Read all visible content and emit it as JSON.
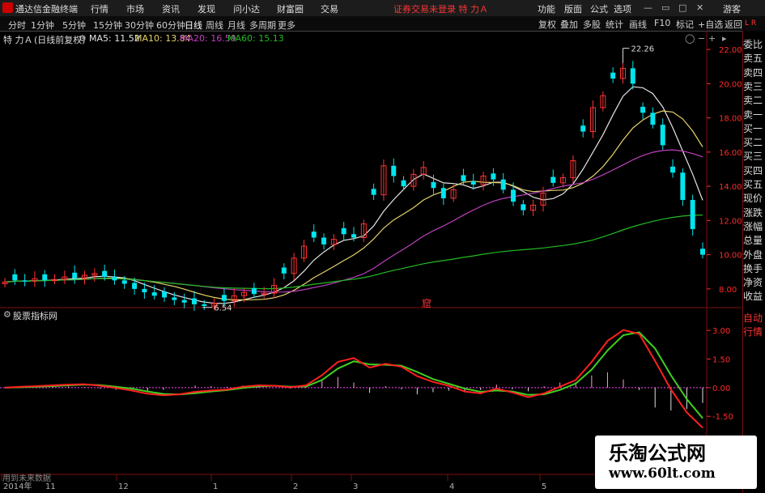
{
  "app": {
    "title": "通达信金融终端",
    "menu": [
      "行情",
      "市场",
      "资讯",
      "发现",
      "问小达",
      "财富圈",
      "交易"
    ],
    "notice": "证券交易未登录 特 力Ａ",
    "right_menu": [
      "功能",
      "版面",
      "公式",
      "选项"
    ],
    "user": "游客"
  },
  "toolbar": {
    "periods": [
      "分时",
      "1分钟",
      "5分钟",
      "15分钟",
      "30分钟",
      "60分钟",
      "日线",
      "周线",
      "月线",
      "多周期",
      "更多"
    ],
    "active_period": "日线",
    "buttons": [
      "复权",
      "叠加",
      "多股",
      "统计",
      "画线",
      "F10",
      "标记",
      "+自选",
      "返回"
    ]
  },
  "stock": {
    "name": "特 力Ａ",
    "adjust": "(日线前复权)",
    "ma5_label": "MA5: 11.52",
    "ma10_label": "MA10: 13.84",
    "ma20_label": "MA20: 16.59",
    "ma60_label": "MA60: 15.13"
  },
  "colors": {
    "up": "#ff3333",
    "down": "#00e5ee",
    "ma5": "#e6e6e6",
    "ma10": "#e6d36a",
    "ma20": "#c040c0",
    "ma60": "#22bb22",
    "axis": "#ff2b2b",
    "macd_dif": "#ff2020",
    "macd_dea": "#40d020"
  },
  "right_panel": [
    "委比",
    "卖五",
    "卖四",
    "卖三",
    "卖二",
    "卖一",
    "买一",
    "买二",
    "买三",
    "买四",
    "买五",
    "现价",
    "涨跌",
    "涨幅",
    "总量",
    "外盘",
    "换手",
    "净资",
    "收益",
    "自动",
    "行情"
  ],
  "indicator": {
    "title": "股票指标网"
  },
  "bottom": {
    "note": "用到未来数据"
  },
  "marker": {
    "text": "窟"
  },
  "watermark": {
    "title": "乐淘公式网",
    "url": "www.60lt.com"
  },
  "chart_data": [
    {
      "type": "candlestick",
      "title": "特 力Ａ (日线前复权)",
      "ylim": [
        7.0,
        23.0
      ],
      "yticks": [
        "22.00",
        "20.00",
        "18.00",
        "16.00",
        "14.00",
        "12.00",
        "10.00",
        "8.00"
      ],
      "x_labels": [
        "2014年",
        "11",
        "12",
        "1",
        "2",
        "3",
        "4",
        "5"
      ],
      "annotations": [
        {
          "text": "22.26",
          "value": 22.26,
          "kind": "high"
        },
        {
          "text": "6.54",
          "value": 6.54,
          "kind": "low"
        }
      ],
      "series": [
        {
          "name": "MA5",
          "value": 11.52
        },
        {
          "name": "MA10",
          "value": 13.84
        },
        {
          "name": "MA20",
          "value": 16.59
        },
        {
          "name": "MA60",
          "value": 15.13
        }
      ],
      "close_path": [
        8.4,
        8.5,
        8.45,
        8.6,
        8.5,
        8.55,
        8.7,
        8.6,
        8.8,
        8.9,
        8.7,
        8.5,
        8.3,
        8.0,
        7.8,
        7.6,
        7.5,
        7.35,
        7.2,
        7.1,
        7.0,
        7.15,
        7.3,
        7.6,
        7.8,
        7.7,
        7.75,
        8.2,
        8.9,
        9.8,
        10.5,
        11.0,
        10.6,
        10.9,
        11.2,
        11.0,
        11.8,
        13.5,
        15.2,
        14.6,
        14.0,
        14.7,
        15.1,
        13.9,
        13.3,
        13.8,
        14.3,
        14.1,
        14.6,
        14.4,
        13.8,
        13.1,
        12.6,
        12.9,
        13.6,
        14.2,
        14.5,
        15.5,
        17.2,
        18.6,
        19.3,
        20.3,
        20.9,
        20.0,
        18.3,
        17.6,
        16.4,
        14.8,
        13.2,
        11.5,
        10.0
      ]
    },
    {
      "type": "line",
      "title": "股票指标网",
      "ylim": [
        -2.0,
        3.6
      ],
      "yticks": [
        "3.00",
        "1.50",
        "0.00",
        "-1.50"
      ],
      "x_labels": [
        "2014年",
        "11",
        "12",
        "1",
        "2",
        "3",
        "4",
        "5"
      ],
      "series": [
        {
          "name": "DIF",
          "values": [
            0.0,
            0.05,
            0.08,
            0.12,
            0.16,
            0.18,
            0.1,
            -0.02,
            -0.15,
            -0.32,
            -0.4,
            -0.35,
            -0.22,
            -0.15,
            -0.1,
            0.05,
            0.12,
            0.1,
            0.02,
            0.12,
            0.65,
            1.35,
            1.55,
            1.05,
            1.25,
            1.1,
            0.6,
            0.3,
            0.1,
            -0.2,
            -0.3,
            -0.05,
            -0.25,
            -0.5,
            -0.3,
            0.05,
            0.4,
            1.35,
            2.45,
            3.02,
            2.82,
            1.4,
            -0.1,
            -1.3,
            -2.1
          ]
        },
        {
          "name": "DEA",
          "values": [
            0.0,
            0.02,
            0.05,
            0.08,
            0.12,
            0.16,
            0.13,
            0.05,
            -0.05,
            -0.2,
            -0.33,
            -0.36,
            -0.29,
            -0.2,
            -0.13,
            -0.02,
            0.07,
            0.1,
            0.05,
            0.06,
            0.4,
            1.0,
            1.38,
            1.22,
            1.2,
            1.15,
            0.82,
            0.45,
            0.2,
            -0.05,
            -0.22,
            -0.15,
            -0.2,
            -0.38,
            -0.35,
            -0.12,
            0.22,
            0.95,
            1.95,
            2.75,
            2.9,
            2.05,
            0.65,
            -0.6,
            -1.6
          ]
        }
      ]
    }
  ]
}
